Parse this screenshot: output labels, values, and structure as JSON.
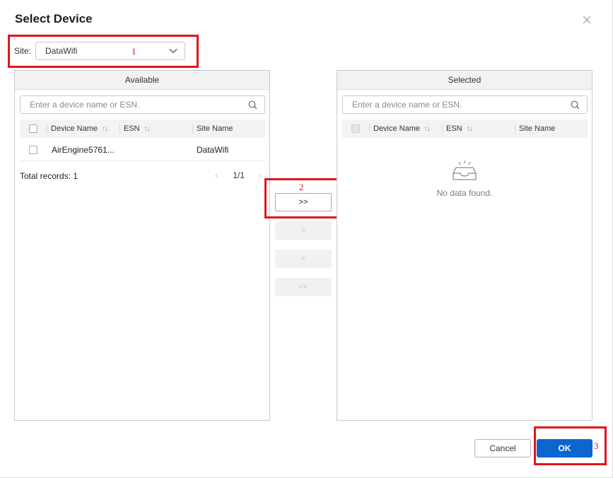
{
  "dialog": {
    "title": "Select Device"
  },
  "site": {
    "label": "Site:",
    "value": "DataWifi"
  },
  "available": {
    "header": "Available",
    "search_placeholder": "Enter a device name or ESN.",
    "columns": [
      "Device Name",
      "ESN",
      "Site Name"
    ],
    "rows": [
      {
        "device_name": "AirEngine5761...",
        "esn": "",
        "site_name": "DataWifi"
      }
    ],
    "total_records": "Total records: 1",
    "page": "1/1"
  },
  "selected": {
    "header": "Selected",
    "search_placeholder": "Enter a device name or ESN.",
    "columns": [
      "Device Name",
      "ESN",
      "Site Name"
    ],
    "empty_text": "No data found."
  },
  "transfer": {
    "add_all": ">>",
    "add": ">",
    "remove": "<",
    "remove_all": "<<"
  },
  "footer": {
    "cancel": "Cancel",
    "ok": "OK"
  },
  "annotations": [
    "1",
    "2",
    "3"
  ],
  "colors": {
    "primary": "#0c66cf",
    "highlight": "#e3141b"
  }
}
